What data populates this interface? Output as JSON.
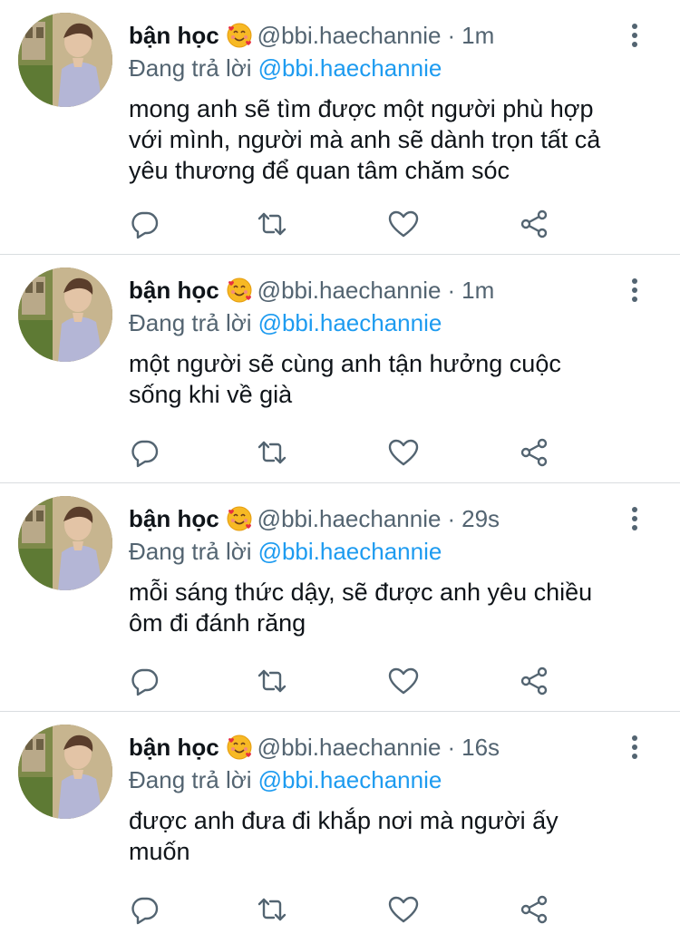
{
  "colors": {
    "accent": "#1d9bf0",
    "text": "#0f1419",
    "secondary": "#536471",
    "divider": "#d9dde0"
  },
  "tweets": [
    {
      "name": "bận học",
      "emoji": "smiling-face-with-hearts",
      "handle": "@bbi.haechannie",
      "dot": "·",
      "time": "1m",
      "reply_prefix": "Đang trả lời",
      "reply_mention": "@bbi.haechannie",
      "lines": [
        "mong anh sẽ tìm được một người phù hợp",
        "với mình, người mà anh sẽ dành trọn tất cả",
        "yêu thương để quan tâm chăm sóc"
      ]
    },
    {
      "name": "bận học",
      "emoji": "smiling-face-with-hearts",
      "handle": "@bbi.haechannie",
      "dot": "·",
      "time": "1m",
      "reply_prefix": "Đang trả lời",
      "reply_mention": "@bbi.haechannie",
      "lines": [
        "một người sẽ cùng anh tận hưởng cuộc",
        "sống khi về già"
      ]
    },
    {
      "name": "bận học",
      "emoji": "smiling-face-with-hearts",
      "handle": "@bbi.haechannie",
      "dot": "·",
      "time": "29s",
      "reply_prefix": "Đang trả lời",
      "reply_mention": "@bbi.haechannie",
      "lines": [
        "mỗi sáng thức dậy, sẽ được anh yêu chiều",
        "ôm đi đánh răng"
      ]
    },
    {
      "name": "bận học",
      "emoji": "smiling-face-with-hearts",
      "handle": "@bbi.haechannie",
      "dot": "·",
      "time": "16s",
      "reply_prefix": "Đang trả lời",
      "reply_mention": "@bbi.haechannie",
      "lines": [
        "được anh đưa đi khắp nơi mà người ấy",
        "muốn"
      ]
    }
  ],
  "icons": {
    "avatar": "avatar-photo",
    "more": "more-vertical-icon",
    "reply": "comment-icon",
    "retweet": "retweet-icon",
    "like": "heart-icon",
    "share": "share-icon"
  }
}
